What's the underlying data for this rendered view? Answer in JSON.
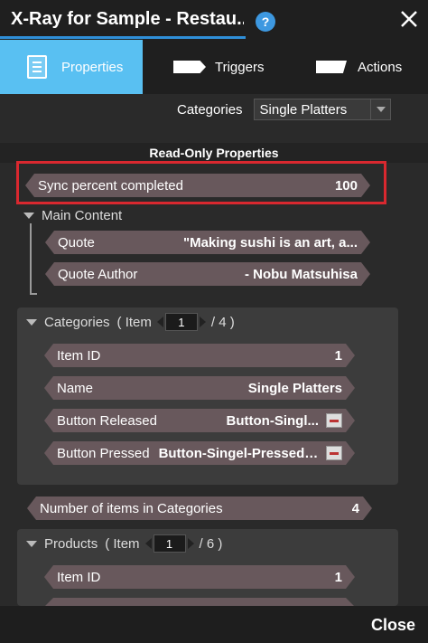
{
  "window": {
    "title": "X-Ray for Sample - Restau...",
    "help_label": "?"
  },
  "tabs": [
    {
      "label": "Properties",
      "icon": "document-icon",
      "active": true
    },
    {
      "label": "Triggers",
      "icon": "trigger-arrow-icon",
      "active": false
    },
    {
      "label": "Actions",
      "icon": "action-arrow-icon",
      "active": false
    }
  ],
  "categories_filter": {
    "label": "Categories",
    "selected": "Single Platters"
  },
  "section_title": "Read-Only Properties",
  "sync": {
    "label": "Sync percent completed",
    "value": "100"
  },
  "main_content": {
    "label": "Main Content",
    "items": [
      {
        "label": "Quote",
        "value": "\"Making sushi is an art, a..."
      },
      {
        "label": "Quote Author",
        "value": "- Nobu Matsuhisa"
      }
    ]
  },
  "categories_group": {
    "label": "Categories",
    "item_word": "( Item",
    "index": "1",
    "total": "/ 4 )",
    "rows": [
      {
        "label": "Item ID",
        "value": "1"
      },
      {
        "label": "Name",
        "value": "Single Platters"
      },
      {
        "label": "Button Released",
        "value": "Button-Singl..."
      },
      {
        "label": "Button Pressed",
        "value": "Button-Singel-Pressed.png"
      }
    ]
  },
  "number_of_items": {
    "label": "Number of items in Categories",
    "value": "4"
  },
  "products_group": {
    "label": "Products",
    "item_word": "( Item",
    "index": "1",
    "total": "/ 6 )",
    "rows": [
      {
        "label": "Item ID",
        "value": "1"
      }
    ]
  },
  "footer": {
    "close_label": "Close"
  },
  "colors": {
    "accent": "#59c0f2",
    "highlight": "#d9282f",
    "pill": "#68585c"
  }
}
